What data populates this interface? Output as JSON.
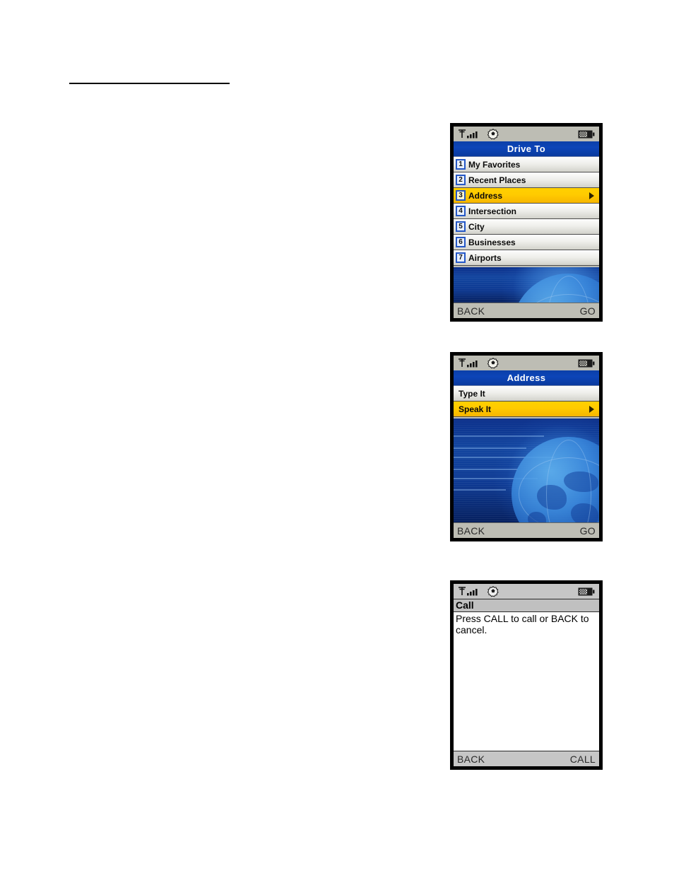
{
  "page": {
    "background_color": "#ffffff",
    "rule_color": "#000000"
  },
  "status_bar": {
    "signal_icon": "signal-strength-icon",
    "settings_icon": "gear-icon",
    "battery_icon": "battery-icon"
  },
  "screens": [
    {
      "id": "drive-to",
      "title": "Drive To",
      "title_bar_color": "#0d45b8",
      "highlight_color": "#ffcb00",
      "items": [
        {
          "number": "1",
          "label": "My Favorites",
          "selected": false
        },
        {
          "number": "2",
          "label": "Recent Places",
          "selected": false
        },
        {
          "number": "3",
          "label": "Address",
          "selected": true
        },
        {
          "number": "4",
          "label": "Intersection",
          "selected": false
        },
        {
          "number": "5",
          "label": "City",
          "selected": false
        },
        {
          "number": "6",
          "label": "Businesses",
          "selected": false
        },
        {
          "number": "7",
          "label": "Airports",
          "selected": false
        }
      ],
      "softkeys": {
        "left": "BACK",
        "right": "GO"
      }
    },
    {
      "id": "address",
      "title": "Address",
      "title_bar_color": "#0d45b8",
      "highlight_color": "#ffcb00",
      "items": [
        {
          "label": "Type It",
          "selected": false
        },
        {
          "label": "Speak It",
          "selected": true
        }
      ],
      "softkeys": {
        "left": "BACK",
        "right": "GO"
      }
    },
    {
      "id": "call",
      "title": "Call",
      "body": "Press CALL to call or BACK to cancel.",
      "softkeys": {
        "left": "BACK",
        "right": "CALL"
      }
    }
  ]
}
